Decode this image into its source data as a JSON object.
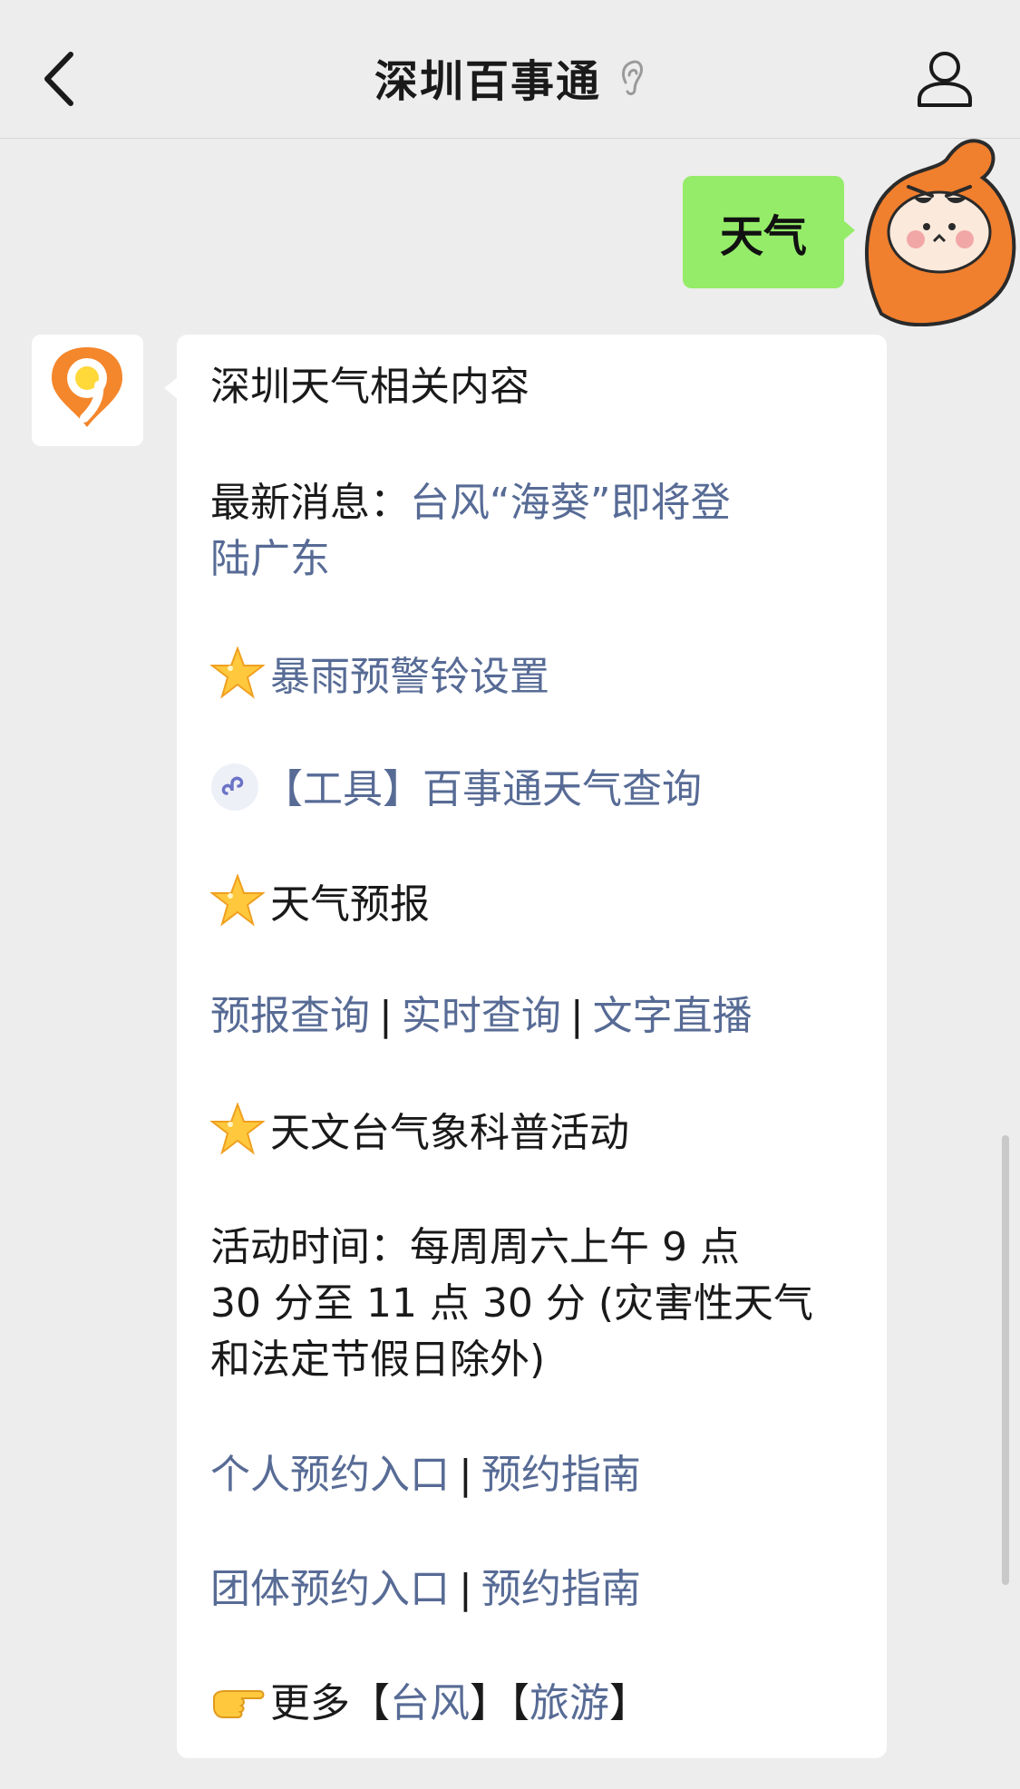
{
  "header": {
    "title": "深圳百事通"
  },
  "sent_message": {
    "text": "天气"
  },
  "reply": {
    "heading": "深圳天气相关内容",
    "latest_label": "最新消息：",
    "latest_link_line1": "台风“海葵”即将登",
    "latest_link_line2": "陆广东",
    "rain_alert": "暴雨预警铃设置",
    "tool_link": "【工具】百事通天气查询",
    "forecast_heading": "天气预报",
    "forecast_links": [
      "预报查询",
      "实时查询",
      "文字直播"
    ],
    "separator": "|",
    "observatory_heading": "天文台气象科普活动",
    "activity_time_line1": "活动时间：每周周六上午 9 点",
    "activity_time_line2": "30 分至 11 点 30 分 (灾害性天气",
    "activity_time_line3": "和法定节假日除外)",
    "personal_entry": "个人预约入口",
    "group_entry": "团体预约入口",
    "booking_guide": "预约指南",
    "more_label": "更多",
    "more_typhoon": "台风",
    "more_travel": "旅游",
    "bracket_open": "【",
    "bracket_close": "】"
  },
  "colors": {
    "background": "#ededed",
    "sent_bubble": "#95ec69",
    "link": "#576b95",
    "brand_orange": "#f4862b"
  },
  "icons": [
    "back-arrow-icon",
    "ear-icon",
    "profile-icon",
    "star-icon",
    "mini-program-icon",
    "pointing-hand-icon"
  ]
}
